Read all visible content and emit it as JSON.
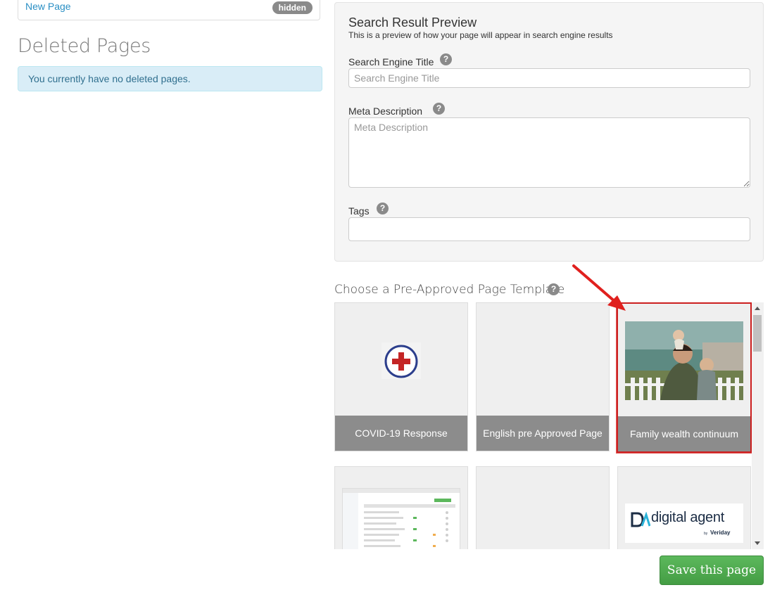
{
  "page_list": {
    "item_label": "New Page",
    "item_badge": "hidden"
  },
  "deleted": {
    "heading": "Deleted Pages",
    "empty_message": "You currently have no deleted pages."
  },
  "seo": {
    "title": "Search Result Preview",
    "subtitle": "This is a preview of how your page will appear in search engine results",
    "search_title_label": "Search Engine Title",
    "search_title_placeholder": "Search Engine Title",
    "search_title_value": "",
    "meta_label": "Meta Description",
    "meta_placeholder": "Meta Description",
    "meta_value": "",
    "tags_label": "Tags",
    "tags_value": "",
    "help_glyph": "?"
  },
  "templates": {
    "heading": "Choose a Pre-Approved Page Template",
    "items": [
      {
        "caption": "COVID-19 Response",
        "icon": "medical-cross-icon"
      },
      {
        "caption": "English pre Approved Page",
        "icon": ""
      },
      {
        "caption": "Family wealth continuum",
        "icon": "family-photo",
        "selected": true
      },
      {
        "caption": "",
        "icon": "spreadsheet-screenshot"
      },
      {
        "caption": "",
        "icon": ""
      },
      {
        "caption": "",
        "icon": "digital-agent-logo"
      }
    ],
    "logo_text": "digital agent",
    "logo_sub_by": "by",
    "logo_sub_brand": "Veriday"
  },
  "actions": {
    "save_label": "Save this page"
  },
  "colors": {
    "accent_link": "#2a8fc4",
    "save_green": "#5cb85c",
    "annotation_red": "#e0201e",
    "info_bg": "#d9edf7"
  }
}
